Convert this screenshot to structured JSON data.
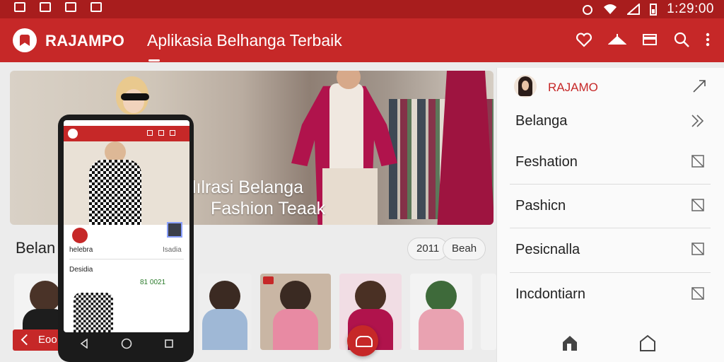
{
  "status_bar": {
    "time": "1:29:00"
  },
  "app_bar": {
    "brand": "RAJAMPO",
    "title": "Aplikasia Belhanga Terbaik"
  },
  "hero": {
    "line1": "lılrasi Belanga",
    "line2": "Fashion Teaak"
  },
  "section": {
    "title": "Belan",
    "chips": [
      "2011",
      "Beah"
    ]
  },
  "bottom_left_button": {
    "label": "Eoo"
  },
  "phone": {
    "shop_name": "helebra",
    "shop_meta": "Isadia",
    "section_label": "Desidia",
    "price_text": "81 0021"
  },
  "right_panel": {
    "user_name": "RAJAMO",
    "items": [
      {
        "label": "Belanga"
      },
      {
        "label": "Feshation"
      },
      {
        "label": "Pashicn"
      },
      {
        "label": "Pesicnalla"
      },
      {
        "label": "Incdontiarn"
      }
    ]
  },
  "colors": {
    "brand_red": "#c62828",
    "status_red": "#a81d1d"
  }
}
